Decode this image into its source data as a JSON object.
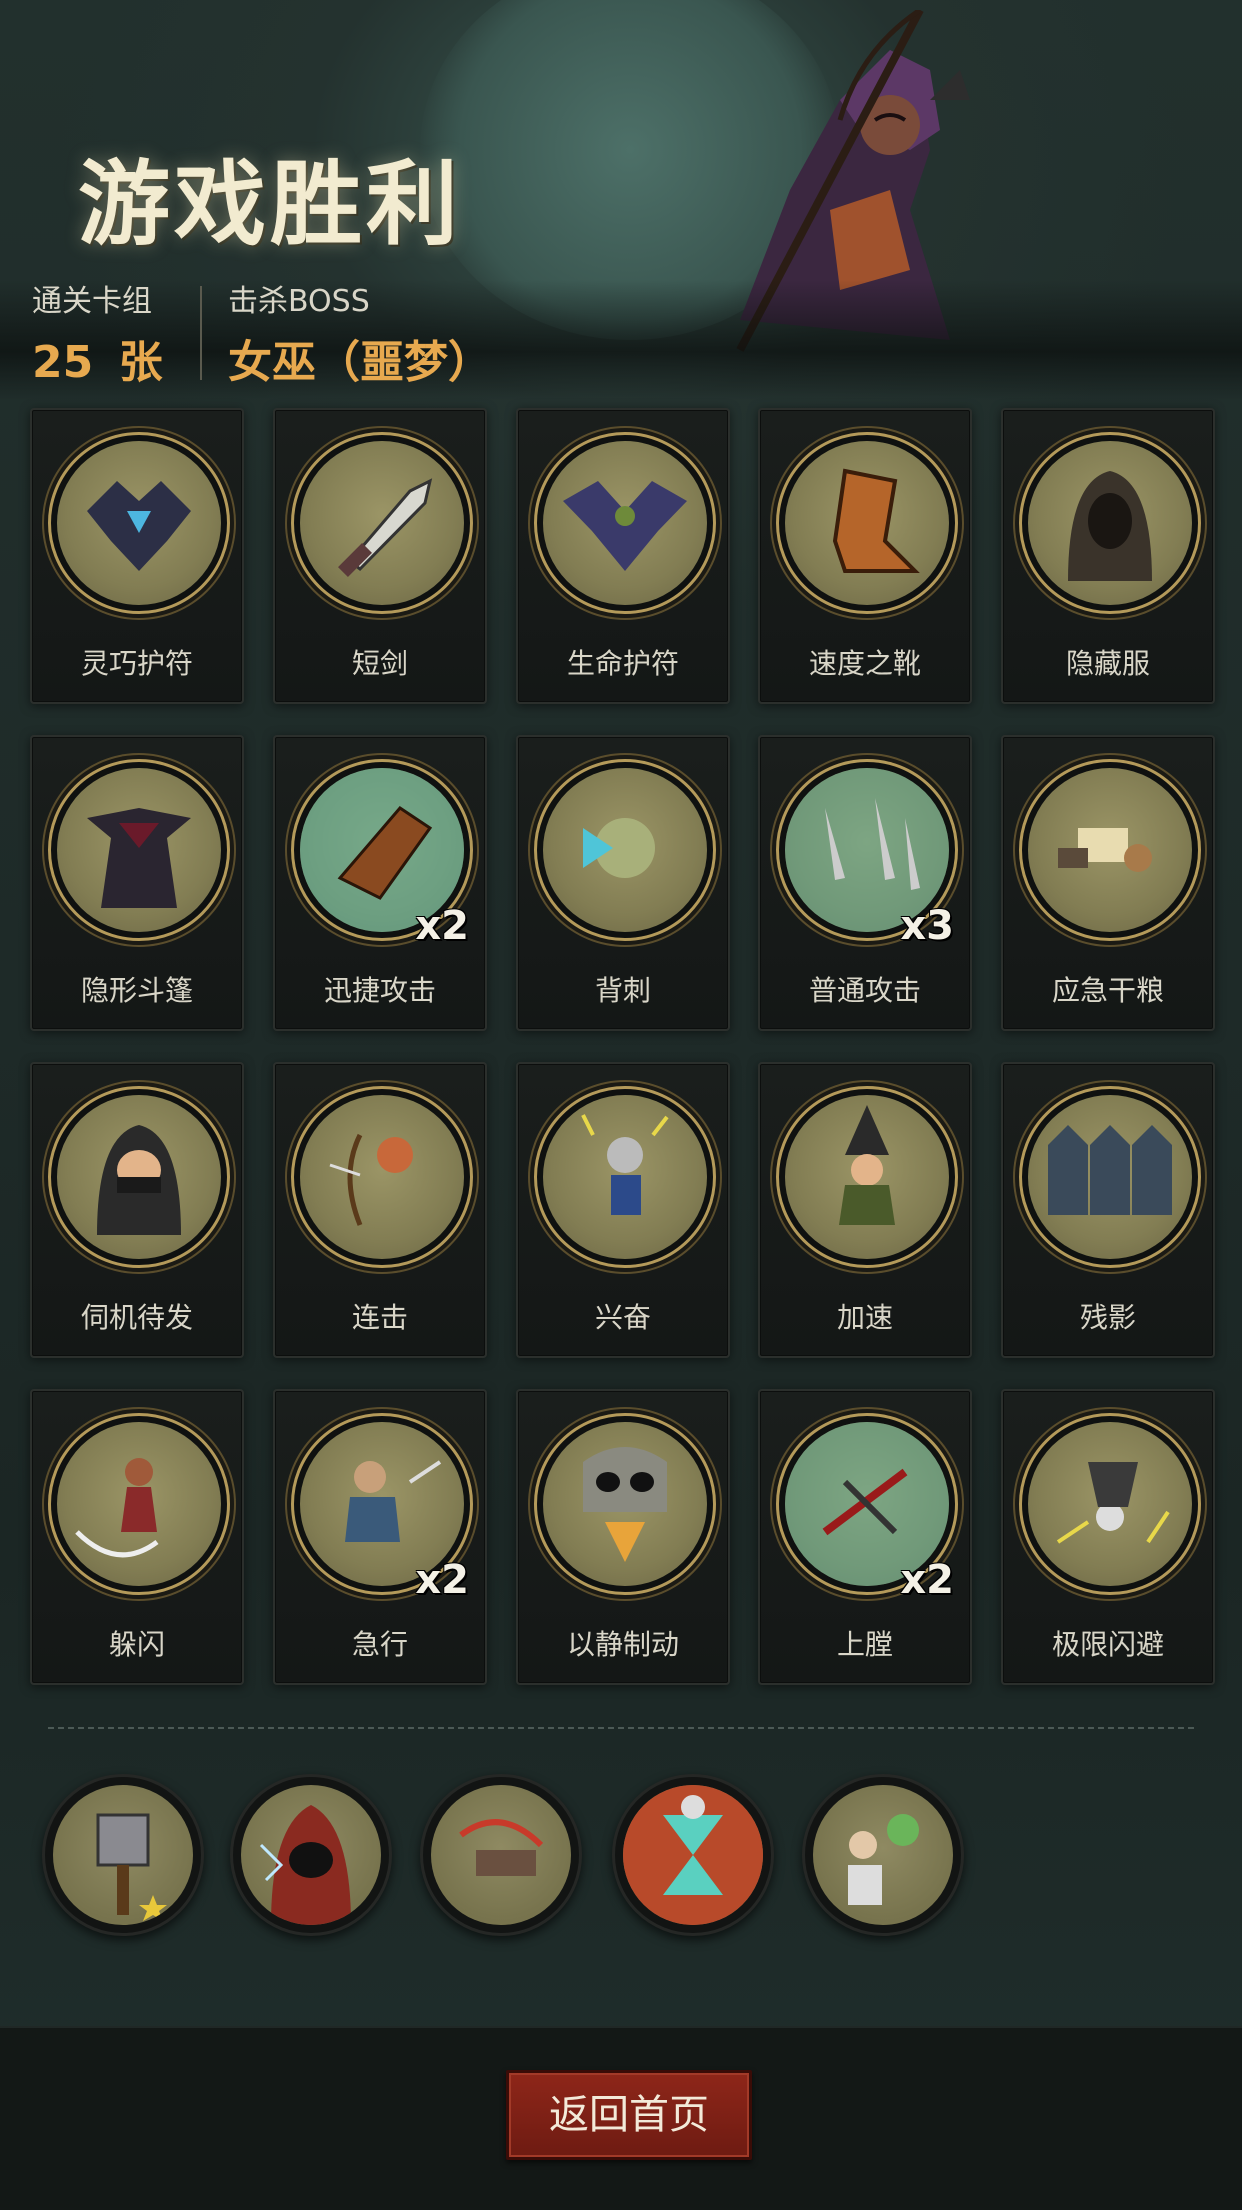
{
  "header": {
    "title": "游戏胜利",
    "deck_label": "通关卡组",
    "deck_count": "25",
    "deck_unit": "张",
    "boss_label": "击杀BOSS",
    "boss_name": "女巫（噩梦）"
  },
  "cards": [
    {
      "name": "灵巧护符",
      "count": "",
      "icon": "bat-amulet-icon"
    },
    {
      "name": "短剑",
      "count": "",
      "icon": "dagger-icon"
    },
    {
      "name": "生命护符",
      "count": "",
      "icon": "bat-charm-icon"
    },
    {
      "name": "速度之靴",
      "count": "",
      "icon": "boot-icon"
    },
    {
      "name": "隐藏服",
      "count": "",
      "icon": "hood-icon"
    },
    {
      "name": "隐形斗篷",
      "count": "",
      "icon": "cloak-icon"
    },
    {
      "name": "迅捷攻击",
      "count": "x2",
      "icon": "swift-attack-icon"
    },
    {
      "name": "背刺",
      "count": "",
      "icon": "backstab-icon"
    },
    {
      "name": "普通攻击",
      "count": "x3",
      "icon": "daggers-icon"
    },
    {
      "name": "应急干粮",
      "count": "",
      "icon": "rations-icon"
    },
    {
      "name": "伺机待发",
      "count": "",
      "icon": "assassin-icon"
    },
    {
      "name": "连击",
      "count": "",
      "icon": "archer-icon"
    },
    {
      "name": "兴奋",
      "count": "",
      "icon": "excited-icon"
    },
    {
      "name": "加速",
      "count": "",
      "icon": "witch-icon"
    },
    {
      "name": "残影",
      "count": "",
      "icon": "afterimage-icon"
    },
    {
      "name": "躲闪",
      "count": "",
      "icon": "dodge-icon"
    },
    {
      "name": "急行",
      "count": "x2",
      "icon": "dash-icon"
    },
    {
      "name": "以静制动",
      "count": "",
      "icon": "skull-icon"
    },
    {
      "name": "上膛",
      "count": "x2",
      "icon": "crossbow-icon"
    },
    {
      "name": "极限闪避",
      "count": "",
      "icon": "extreme-dodge-icon"
    }
  ],
  "relics": [
    {
      "icon": "hammer-relic-icon"
    },
    {
      "icon": "hooded-mage-relic-icon"
    },
    {
      "icon": "crossbow-relic-icon"
    },
    {
      "icon": "hourglass-relic-icon"
    },
    {
      "icon": "zombie-relic-icon"
    }
  ],
  "footer": {
    "home_button": "返回首页"
  },
  "colors": {
    "accent": "#e7a94f",
    "button": "#8e2619",
    "medal": "#8f8a62"
  }
}
